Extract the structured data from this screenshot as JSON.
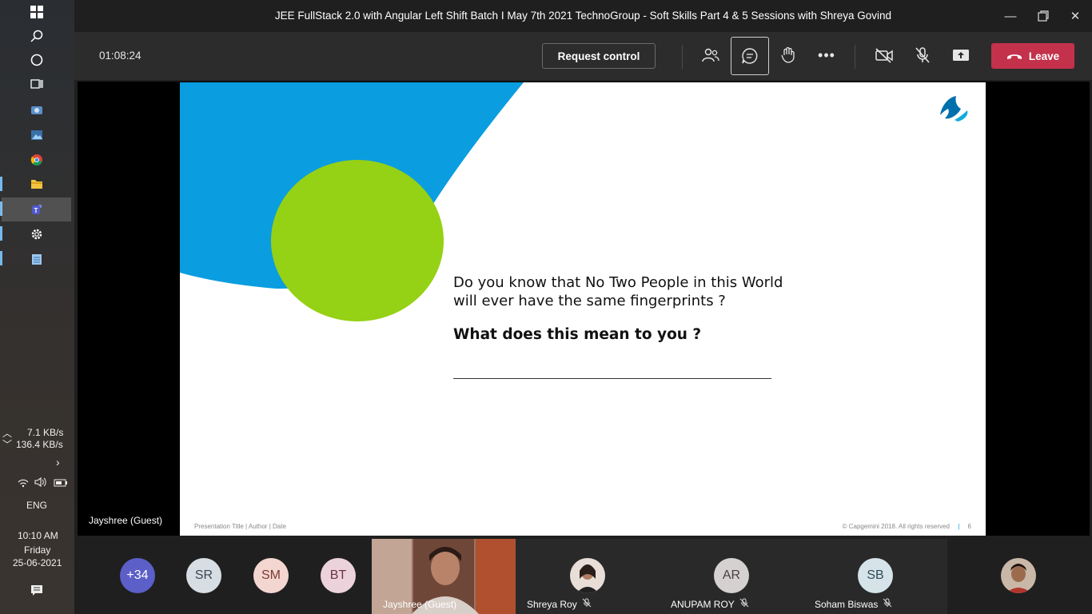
{
  "window": {
    "title": "JEE FullStack 2.0 with Angular Left Shift Batch I May 7th 2021 TechnoGroup - Soft Skills Part 4 & 5 Sessions with Shreya Govind"
  },
  "taskbar": {
    "net_up": "7.1 KB/s",
    "net_down": "136.4 KB/s",
    "language": "ENG",
    "time": "10:10 AM",
    "day": "Friday",
    "date": "25-06-2021"
  },
  "toolbar": {
    "timer": "01:08:24",
    "request_control_label": "Request control",
    "leave_label": "Leave"
  },
  "slide": {
    "question_line1": "Do you know that No Two People in this World",
    "question_line2": "will ever have the same fingerprints ?",
    "question_bold": "What does this mean to you ?",
    "footer_left": "Presentation Title | Author | Date",
    "footer_right": "© Capgemini 2018. All rights reserved",
    "page_number": "6"
  },
  "stage": {
    "speaker_label": "Jayshree (Guest)"
  },
  "participants": {
    "overflow_count": "+34",
    "avatars": [
      {
        "initials": "SR",
        "bg": "#d6dde3",
        "fg": "#3b4654"
      },
      {
        "initials": "SM",
        "bg": "#f4d6d1",
        "fg": "#7a3b33"
      },
      {
        "initials": "BT",
        "bg": "#ecd2da",
        "fg": "#6e3345"
      }
    ],
    "tiles": [
      {
        "name": "Jayshree (Guest)"
      },
      {
        "name": "Shreya Roy"
      },
      {
        "name": "ANUPAM ROY",
        "initials": "AR"
      },
      {
        "name": "Soham Biswas",
        "initials": "SB"
      }
    ]
  },
  "colors": {
    "leave": "#c4314b",
    "slide_blue": "#0a9de0",
    "slide_green": "#95d114",
    "overflow_badge": "#5b5fc7"
  }
}
